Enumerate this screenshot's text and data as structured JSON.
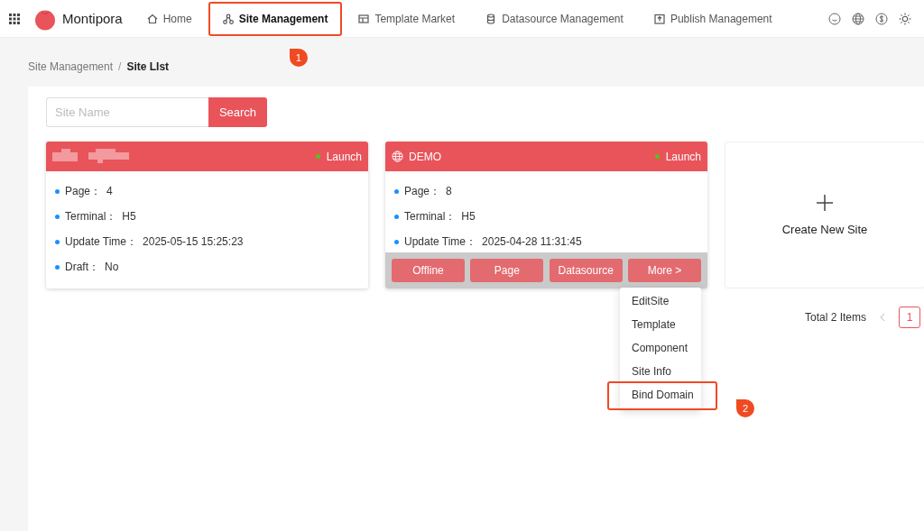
{
  "header": {
    "brand": "Montipora",
    "nav": [
      {
        "label": "Home",
        "selected": false,
        "highlighted": false
      },
      {
        "label": "Site Management",
        "selected": true,
        "highlighted": true,
        "marker": "1"
      },
      {
        "label": "Template Market",
        "selected": false,
        "highlighted": false
      },
      {
        "label": "Datasource Management",
        "selected": false,
        "highlighted": false
      },
      {
        "label": "Publish Management",
        "selected": false,
        "highlighted": false
      }
    ]
  },
  "breadcrumb": {
    "separator": "/",
    "items": [
      "Site Management",
      "Site LIst"
    ]
  },
  "search": {
    "placeholder": "Site Name",
    "button": "Search"
  },
  "sites": [
    {
      "title_hidden": true,
      "status": "Launch",
      "hovered": false,
      "fields": [
        {
          "label": "Page：",
          "value": "4"
        },
        {
          "label": "Terminal：",
          "value": "H5"
        },
        {
          "label": "Update Time：",
          "value": "2025-05-15 15:25:23"
        },
        {
          "label": "Draft：",
          "value": "No"
        }
      ]
    },
    {
      "title_hidden": false,
      "title": "DEMO",
      "status": "Launch",
      "hovered": true,
      "fields": [
        {
          "label": "Page：",
          "value": "8"
        },
        {
          "label": "Terminal：",
          "value": "H5"
        },
        {
          "label": "Update Time：",
          "value": "2025-04-28 11:31:45"
        }
      ],
      "actions": [
        "Offline",
        "Page",
        "Datasource",
        "More >"
      ],
      "menu_open": true,
      "menu": [
        {
          "label": "EditSite",
          "highlighted": false
        },
        {
          "label": "Template",
          "highlighted": false
        },
        {
          "label": "Component",
          "highlighted": false
        },
        {
          "label": "Site Info",
          "highlighted": false
        },
        {
          "label": "Bind Domain",
          "highlighted": true,
          "marker": "2"
        }
      ]
    }
  ],
  "create_label": "Create New Site",
  "pagination": {
    "total": "Total 2 Items",
    "pages": [
      {
        "label": "1",
        "selected": true
      }
    ]
  }
}
